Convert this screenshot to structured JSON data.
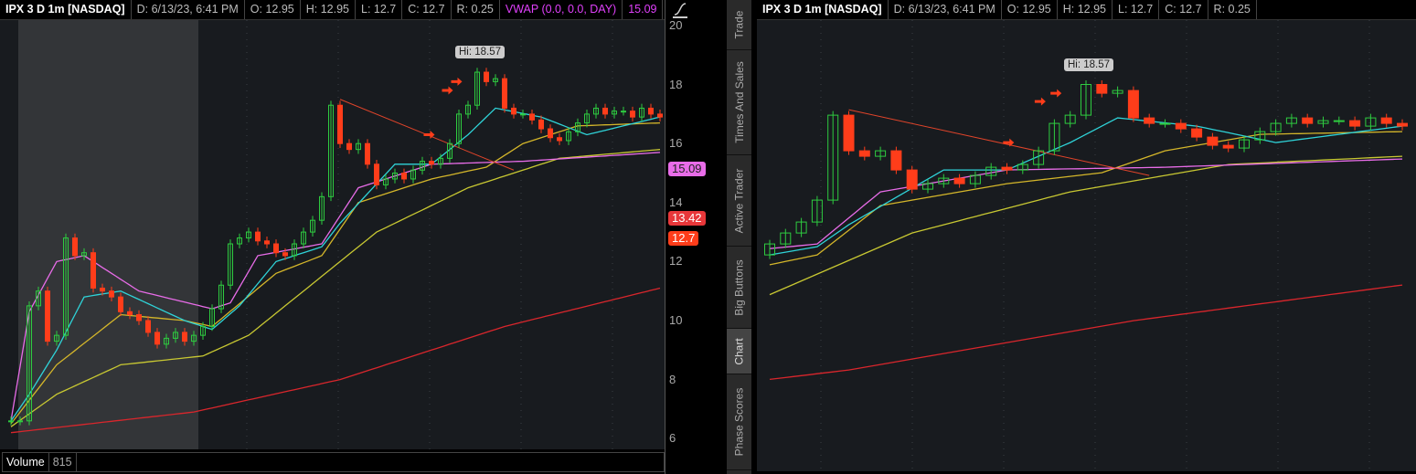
{
  "left_chart": {
    "header": {
      "symbol": "IPX 3 D 1m [NASDAQ]",
      "date": "D: 6/13/23, 6:41 PM",
      "open": "O: 12.95",
      "high": "H: 12.95",
      "low": "L: 12.7",
      "close": "C: 12.7",
      "range": "R: 0.25",
      "vwap_label": "VWAP (0.0, 0.0, DAY)",
      "vwap_value": "15.09",
      "more": "..."
    },
    "price_ticks": [
      "20",
      "18",
      "16",
      "14",
      "12",
      "10",
      "8",
      "6"
    ],
    "badges": {
      "vwap": "15.09",
      "ma": "13.42",
      "last": "12.7"
    },
    "hi_label": "Hi: 18.57",
    "volume": {
      "label": "Volume",
      "value": "815"
    }
  },
  "right_chart": {
    "header": {
      "symbol": "IPX 3 D 1m [NASDAQ]",
      "date": "D: 6/13/23, 6:41 PM",
      "open": "O: 12.95",
      "high": "H: 12.95",
      "low": "L: 12.7",
      "close": "C: 12.7",
      "range": "R: 0.25"
    },
    "hi_label": "Hi: 18.57"
  },
  "side_tabs": [
    "Trade",
    "Times And Sales",
    "Active Trader",
    "Big Buttons",
    "Chart",
    "Phase Scores"
  ],
  "active_tab": "Chart",
  "colors": {
    "up": "#2ecc40",
    "down": "#ff3d1a",
    "cyan": "#2fd3d8",
    "vwap": "#e86ce8",
    "yellow": "#d4b62a",
    "olive": "#c8c832",
    "red": "#d9262c"
  },
  "chart_data": {
    "type": "candlestick",
    "closes": [
      6.6,
      6.6,
      10.5,
      11,
      9.3,
      9.5,
      12.8,
      12.2,
      12.3,
      11.1,
      11,
      10.8,
      10.3,
      10.2,
      10,
      9.6,
      9.2,
      9.4,
      9.6,
      9.3,
      9.5,
      9.8,
      10.4,
      11.2,
      12.6,
      12.8,
      13,
      12.7,
      12.6,
      12.3,
      12.2,
      12.6,
      13,
      13.4,
      14.2,
      17.3,
      16,
      15.8,
      16,
      15.3,
      14.6,
      14.8,
      15,
      14.8,
      15.1,
      15.4,
      15.3,
      15.5,
      16,
      17,
      17.3,
      18.42,
      18.1,
      18.2,
      17.2,
      17,
      17,
      16.8,
      16.5,
      16.2,
      16.1,
      16.4,
      16.7,
      17,
      17.2,
      17,
      17.1,
      17.1,
      16.9,
      17.2,
      17,
      16.9
    ],
    "signal_bars": [
      47,
      49,
      50
    ],
    "hi": 18.57,
    "lines": {
      "cyan": [
        [
          0,
          6.6
        ],
        [
          2,
          7.5
        ],
        [
          5,
          9
        ],
        [
          8,
          10.8
        ],
        [
          12,
          11
        ],
        [
          19,
          10
        ],
        [
          22,
          9.7
        ],
        [
          25,
          10.5
        ],
        [
          29,
          12
        ],
        [
          34,
          12.5
        ],
        [
          36,
          13.3
        ],
        [
          42,
          15.3
        ],
        [
          46,
          15.3
        ],
        [
          50,
          16.3
        ],
        [
          53,
          17.2
        ],
        [
          58,
          16.9
        ],
        [
          63,
          16.3
        ],
        [
          71,
          16.9
        ]
      ],
      "vwap": [
        [
          0,
          6.6
        ],
        [
          2,
          10.3
        ],
        [
          5,
          12
        ],
        [
          8,
          12.2
        ],
        [
          14,
          11
        ],
        [
          22,
          10.4
        ],
        [
          24,
          10.6
        ],
        [
          27,
          12.2
        ],
        [
          34,
          12.6
        ],
        [
          38,
          14.5
        ],
        [
          46,
          15.3
        ],
        [
          56,
          15.4
        ],
        [
          71,
          15.7
        ]
      ],
      "yellow": [
        [
          0,
          6.5
        ],
        [
          5,
          8.5
        ],
        [
          12,
          10.2
        ],
        [
          19,
          10
        ],
        [
          22,
          9.8
        ],
        [
          29,
          11.6
        ],
        [
          34,
          12.2
        ],
        [
          38,
          14
        ],
        [
          46,
          14.8
        ],
        [
          52,
          15.2
        ],
        [
          56,
          16
        ],
        [
          62,
          16.6
        ],
        [
          71,
          16.7
        ]
      ],
      "olive": [
        [
          0,
          6.4
        ],
        [
          5,
          7.5
        ],
        [
          12,
          8.5
        ],
        [
          21,
          8.8
        ],
        [
          26,
          9.5
        ],
        [
          32,
          11
        ],
        [
          40,
          13
        ],
        [
          50,
          14.5
        ],
        [
          60,
          15.5
        ],
        [
          71,
          15.8
        ]
      ],
      "red": [
        [
          0,
          6.2
        ],
        [
          20,
          6.9
        ],
        [
          36,
          8
        ],
        [
          54,
          9.8
        ],
        [
          71,
          11.1
        ]
      ]
    },
    "trendline": [
      [
        36,
        17.5
      ],
      [
        55,
        15.1
      ]
    ],
    "ylim": [
      5.8,
      20.2
    ]
  }
}
